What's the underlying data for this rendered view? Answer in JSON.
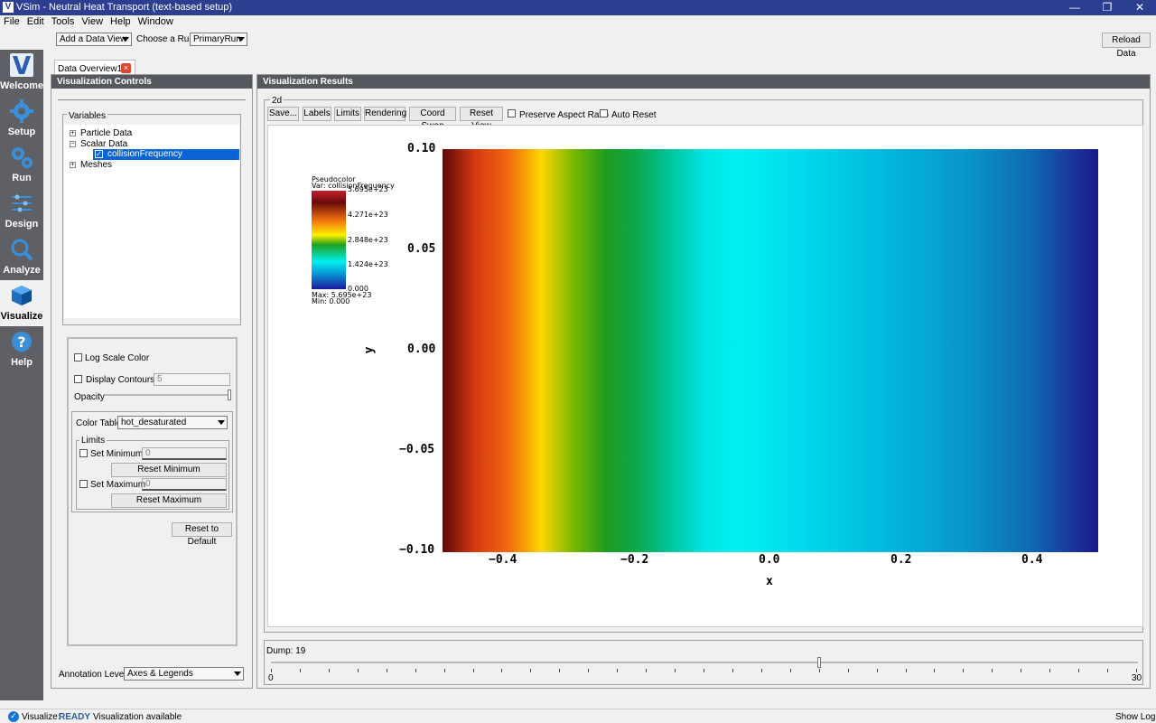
{
  "window": {
    "title": "VSim - Neutral Heat Transport (text-based setup)",
    "min": "—",
    "restore": "❐",
    "close": "✕"
  },
  "menu": [
    "File",
    "Edit",
    "Tools",
    "View",
    "Help",
    "Window"
  ],
  "toolbar": {
    "add_view": "Add a Data View",
    "choose_run_label": "Choose a Run:",
    "run_value": "PrimaryRun",
    "reload": "Reload Data"
  },
  "sidebar": [
    {
      "label": "Welcome",
      "icon": "vsim-logo-icon"
    },
    {
      "label": "Setup",
      "icon": "gear-icon"
    },
    {
      "label": "Run",
      "icon": "gears-icon"
    },
    {
      "label": "Design",
      "icon": "design-icon"
    },
    {
      "label": "Analyze",
      "icon": "magnifier-icon"
    },
    {
      "label": "Visualize",
      "icon": "cube-icon"
    },
    {
      "label": "Help",
      "icon": "question-icon"
    }
  ],
  "tab": {
    "label": "Data Overview1"
  },
  "controls": {
    "header": "Visualization Controls",
    "variables_label": "Variables",
    "tree": {
      "particle": "Particle Data",
      "scalar": "Scalar Data",
      "selected": "collisionFrequency",
      "meshes": "Meshes"
    },
    "log_scale": "Log Scale Color",
    "display_contours": "Display Contours",
    "contours_value": "5",
    "opacity": "Opacity",
    "color_table_label": "Color Table",
    "color_table_value": "hot_desaturated",
    "limits_label": "Limits",
    "set_min": "Set Minimum",
    "min_value": "0",
    "reset_min": "Reset Minimum",
    "set_max": "Set Maximum",
    "max_value": "0",
    "reset_max": "Reset Maximum",
    "reset_default": "Reset to Default",
    "annotation_label": "Annotation Level:",
    "annotation_value": "Axes & Legends"
  },
  "results": {
    "header": "Visualization Results",
    "group": "2d",
    "buttons": [
      "Save...",
      "Labels",
      "Limits",
      "Rendering",
      "Coord Swap",
      "Reset View"
    ],
    "preserve": "Preserve Aspect Ratio",
    "auto_reset": "Auto Reset",
    "dump_label": "Dump: 19",
    "slider_min": "0",
    "slider_max": "30",
    "slider_value": 19
  },
  "legend": {
    "title": "Pseudocolor",
    "var": "Var: collisionFrequency",
    "ticks": [
      "5.695e+23",
      "4.271e+23",
      "2.848e+23",
      "1.424e+23",
      "0.000"
    ],
    "max": "Max:  5.695e+23",
    "min": "Min:  0.000"
  },
  "chart_data": {
    "type": "heatmap",
    "xlabel": "x",
    "ylabel": "y",
    "xlim": [
      -0.5,
      0.5
    ],
    "ylim": [
      -0.1,
      0.1
    ],
    "xticks": [
      "−0.4",
      "−0.2",
      "0.0",
      "0.2",
      "0.4"
    ],
    "yticks": [
      "0.10",
      "0.05",
      "0.00",
      "−0.05",
      "−0.10"
    ],
    "xtick_values": [
      -0.4,
      -0.2,
      0.0,
      0.2,
      0.4
    ],
    "ytick_values": [
      0.1,
      0.05,
      0.0,
      -0.05,
      -0.1
    ],
    "colormap": "hot_desaturated",
    "value_range": [
      0,
      5.695e+23
    ],
    "profile_x": [
      -0.5,
      -0.45,
      -0.4,
      -0.35,
      -0.3,
      -0.25,
      -0.2,
      -0.15,
      -0.1,
      -0.05,
      0.0,
      0.05,
      0.1,
      0.15,
      0.2,
      0.25,
      0.3,
      0.35,
      0.4,
      0.45,
      0.5
    ],
    "profile_color": [
      "#5a0a0a",
      "#d63a10",
      "#f0680f",
      "#ffd500",
      "#7ab800",
      "#1e9a1e",
      "#0aaa50",
      "#00c8a0",
      "#00e4e4",
      "#00f0f0",
      "#00e6ef",
      "#00d8ec",
      "#00cce6",
      "#00bfe0",
      "#02b2d8",
      "#06a5d0",
      "#0a95c8",
      "#0c80bc",
      "#0f68b0",
      "#1a3da0",
      "#1a1a8a"
    ]
  },
  "status": {
    "label": "Visualize:",
    "state": "READY",
    "message": "Visualization available",
    "show_log": "Show Log"
  }
}
